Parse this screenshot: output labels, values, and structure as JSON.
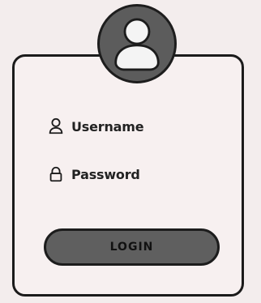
{
  "login_form": {
    "avatar_icon": "user-avatar-icon",
    "username_icon": "user-icon",
    "username_label": "Username",
    "password_icon": "lock-icon",
    "password_label": "Password",
    "login_button_label": "LOGIN"
  },
  "colors": {
    "background": "#f3eded",
    "card_background": "#f7f0f0",
    "outline": "#1b1b1b",
    "avatar_fill": "#5c5c5c",
    "button_fill": "#5f5f5f"
  }
}
